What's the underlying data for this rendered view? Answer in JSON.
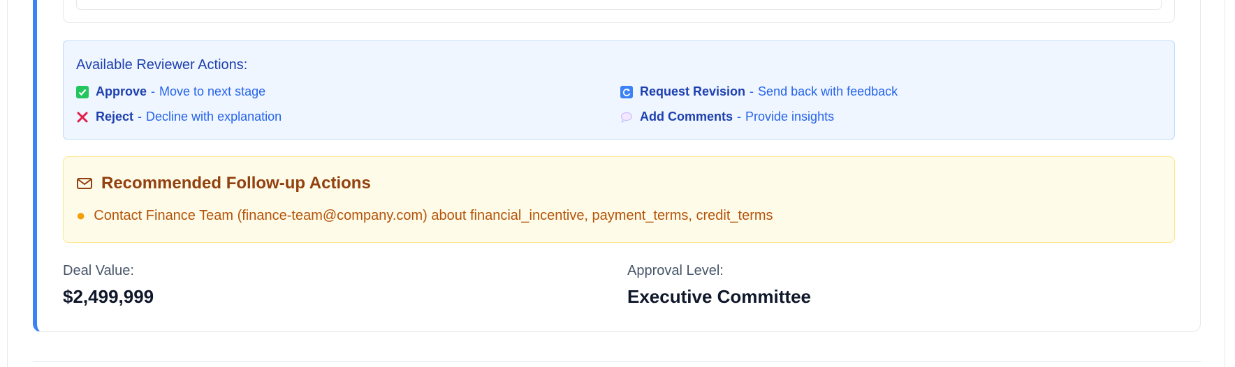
{
  "reviewer_actions": {
    "title": "Available Reviewer Actions:",
    "items": [
      {
        "icon": "check-box-icon",
        "label": "Approve",
        "description": "Move to next stage"
      },
      {
        "icon": "cross-icon",
        "label": "Reject",
        "description": "Decline with explanation"
      },
      {
        "icon": "refresh-icon",
        "label": "Request Revision",
        "description": "Send back with feedback"
      },
      {
        "icon": "speech-bubble-icon",
        "label": "Add Comments",
        "description": "Provide insights"
      }
    ],
    "separator": "-"
  },
  "followup": {
    "title": "Recommended Follow-up Actions",
    "icon": "envelope-icon",
    "items": [
      "Contact Finance Team (finance-team@company.com) about financial_incentive, payment_terms, credit_terms"
    ]
  },
  "deal": {
    "value_label": "Deal Value:",
    "value": "$2,499,999",
    "approval_label": "Approval Level:",
    "approval": "Executive Committee"
  },
  "colors": {
    "accent": "#3b82f6",
    "actions_bg": "#eff6ff",
    "followup_bg": "#fefbe8"
  }
}
